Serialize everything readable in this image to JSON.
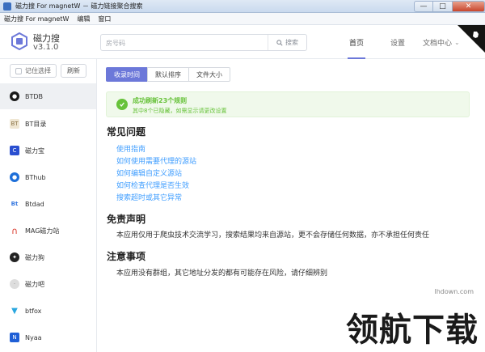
{
  "window": {
    "title": "磁力搜 For magnetW － 磁力链接聚合搜索",
    "min_glyph": "—",
    "max_glyph": "□",
    "close_glyph": "✕"
  },
  "menubar": {
    "items": [
      "磁力搜 For magnetW",
      "编辑",
      "窗口"
    ]
  },
  "header": {
    "brand_name": "磁力搜",
    "version": "v3.1.0",
    "search_placeholder": "房号码",
    "search_button": "搜索",
    "nav": {
      "home": "首页",
      "settings": "设置",
      "docs": "文档中心"
    }
  },
  "sidebar": {
    "remember_label": "记住选择",
    "refresh_label": "刷新",
    "items": [
      {
        "label": "BTDB",
        "icon": "btdb-icon",
        "color": "#1a1a1a"
      },
      {
        "label": "BT目录",
        "icon": "bt-catalog-icon",
        "color": "#c9b48a"
      },
      {
        "label": "磁力宝",
        "icon": "cilibao-icon",
        "color": "#2a4fd0"
      },
      {
        "label": "BThub",
        "icon": "bthub-icon",
        "color": "#1e6fd9"
      },
      {
        "label": "Btdad",
        "icon": "btdad-icon",
        "color": "#3b7be0"
      },
      {
        "label": "MAG磁力站",
        "icon": "magnet-icon",
        "color": "#d9382b"
      },
      {
        "label": "磁力狗",
        "icon": "dog-icon",
        "color": "#222222"
      },
      {
        "label": "磁力吧",
        "icon": "ciliba-icon",
        "color": "#c7c7c7"
      },
      {
        "label": "btfox",
        "icon": "fox-icon",
        "color": "#2aa7df"
      },
      {
        "label": "Nyaa",
        "icon": "nyaa-icon",
        "color": "#1f5fd6"
      }
    ]
  },
  "main": {
    "tabs": [
      {
        "label": "收录时间",
        "active": true
      },
      {
        "label": "默认排序",
        "active": false
      },
      {
        "label": "文件大小",
        "active": false
      }
    ],
    "alert": {
      "title": "成功刷新23个规则",
      "desc": "其中8个已隐藏，如需显示请更改设置"
    },
    "faq": {
      "heading": "常见问题",
      "links": [
        "使用指南",
        "如何使用需要代理的源站",
        "如何编辑自定义源站",
        "如何检查代理是否生效",
        "搜索超时或其它异常"
      ]
    },
    "disclaimer": {
      "heading": "免责声明",
      "text": "本应用仅用于爬虫技术交流学习，搜索结果均来自源站，更不会存储任何数据，亦不承担任何责任"
    },
    "notice": {
      "heading": "注意事项",
      "text": "本应用没有群组，其它地址分发的都有可能存在风险，请仔细辨别"
    }
  },
  "watermark": {
    "brand": "领航下载",
    "url": "lhdown.com"
  },
  "colors": {
    "accent": "#6c78d9",
    "link": "#409eff",
    "success": "#67c23a"
  }
}
